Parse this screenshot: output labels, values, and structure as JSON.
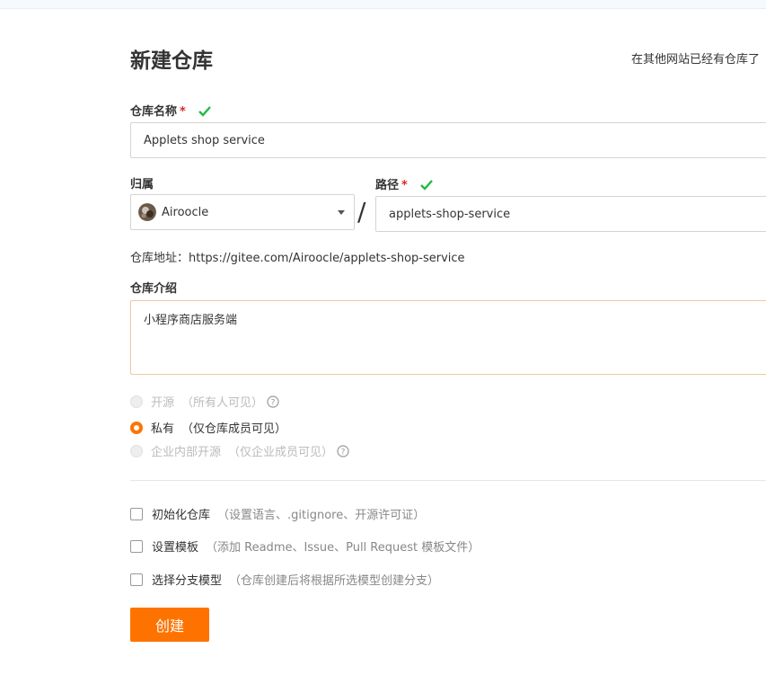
{
  "page": {
    "title": "新建仓库",
    "import_hint": "在其他网站已经有仓库了"
  },
  "form": {
    "name_label": "仓库名称",
    "required_mark": "*",
    "name_value": "Applets shop service",
    "owner_label": "归属",
    "owner_value": "Airoocle",
    "slash": "/",
    "path_label": "路径",
    "path_value": "applets-shop-service",
    "repo_url_text": "仓库地址：https://gitee.com/Airoocle/applets-shop-service",
    "desc_label": "仓库介绍",
    "desc_value": "小程序商店服务端"
  },
  "visibility": [
    {
      "label": "开源",
      "hint": "（所有人可见）",
      "state": "disabled"
    },
    {
      "label": "私有",
      "hint": "（仅仓库成员可见）",
      "state": "checked"
    },
    {
      "label": "企业内部开源",
      "hint": "（仅企业成员可见）",
      "state": "disabled"
    }
  ],
  "options": [
    {
      "label": "初始化仓库",
      "hint": "（设置语言、.gitignore、开源许可证）"
    },
    {
      "label": "设置模板",
      "hint": "（添加 Readme、Issue、Pull Request 模板文件）"
    },
    {
      "label": "选择分支模型",
      "hint": "（仓库创建后将根据所选模型创建分支）"
    }
  ],
  "actions": {
    "create_label": "创建"
  },
  "colors": {
    "accent": "#fe7300",
    "success": "#21ba45",
    "required": "#db2828"
  },
  "icons": [
    "check-icon",
    "caret-down-icon",
    "question-circle-icon",
    "avatar-image"
  ]
}
